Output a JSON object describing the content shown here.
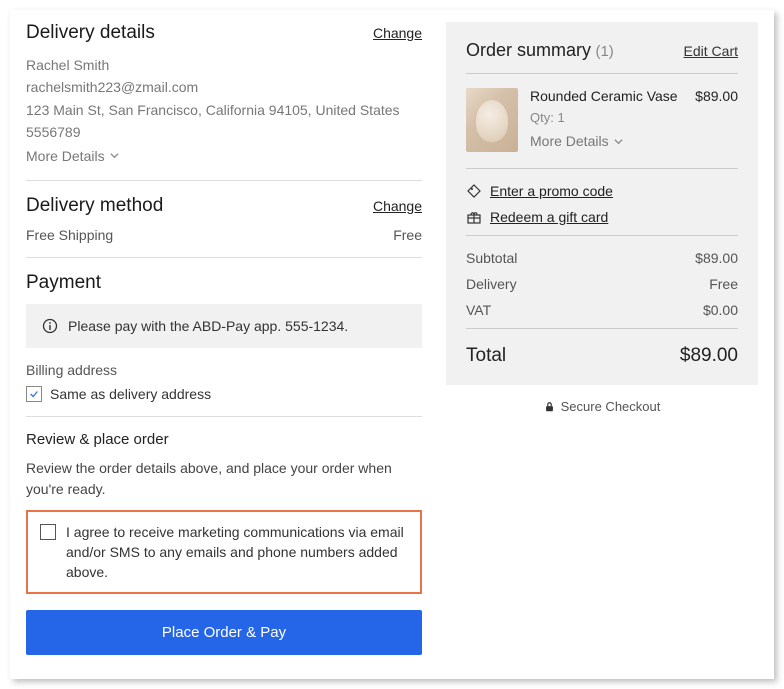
{
  "delivery": {
    "heading": "Delivery details",
    "change": "Change",
    "name": "Rachel Smith",
    "email": "rachelsmith223@zmail.com",
    "address": "123 Main St, San Francisco, California 94105, United States",
    "phone": "5556789",
    "more": "More Details"
  },
  "method": {
    "heading": "Delivery method",
    "change": "Change",
    "name": "Free Shipping",
    "price": "Free"
  },
  "payment": {
    "heading": "Payment",
    "message": "Please pay with the ABD-Pay app.  555-1234.",
    "billing_label": "Billing address",
    "same_as": "Same as delivery address"
  },
  "review": {
    "heading": "Review & place order",
    "text": "Review the order details above, and place your order when you're ready.",
    "agree": "I agree to receive marketing communications via email and/or SMS to any emails and phone numbers added above.",
    "button": "Place Order & Pay"
  },
  "summary": {
    "heading": "Order summary",
    "count": "(1)",
    "edit": "Edit Cart",
    "item": {
      "name": "Rounded Ceramic Vase",
      "qty": "Qty: 1",
      "more": "More Details",
      "price": "$89.00"
    },
    "promo": "Enter a promo code",
    "gift": "Redeem a gift card",
    "subtotal_label": "Subtotal",
    "subtotal": "$89.00",
    "delivery_label": "Delivery",
    "delivery": "Free",
    "vat_label": "VAT",
    "vat": "$0.00",
    "total_label": "Total",
    "total": "$89.00",
    "secure": "Secure Checkout"
  }
}
